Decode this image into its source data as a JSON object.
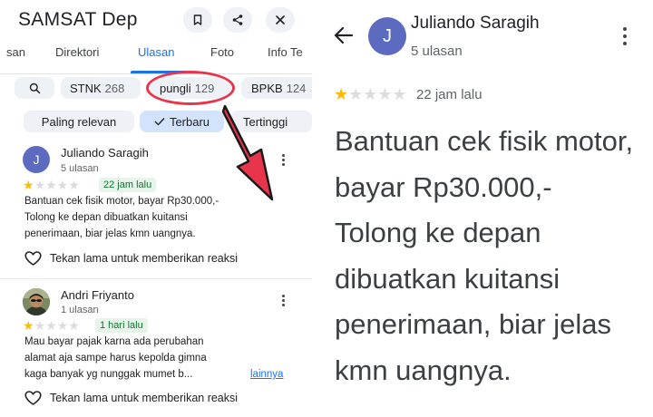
{
  "left": {
    "title": "SAMSAT Dep",
    "header_icons": [
      "bookmark-icon",
      "share-icon",
      "close-icon"
    ],
    "tabs": [
      "san",
      "Direktori",
      "Ulasan",
      "Foto",
      "Info Te"
    ],
    "active_tab": "Ulasan",
    "topic_chips": [
      {
        "label": "STNK",
        "count": "268"
      },
      {
        "label": "pungli",
        "count": "129"
      },
      {
        "label": "BPKB",
        "count": "124"
      }
    ],
    "sort_chips": [
      "Paling relevan",
      "Terbaru",
      "Tertinggi"
    ],
    "sort_selected": "Terbaru",
    "annotation_color": "#e8354b",
    "reviews": [
      {
        "avatar_letter": "J",
        "avatar_color": "#5c6bc0",
        "name": "Juliando Saragih",
        "sub": "5 ulasan",
        "rating": 1,
        "date": "22 jam lalu",
        "lines": [
          "Bantuan cek fisik motor, bayar Rp30.000,-",
          "Tolong ke depan dibuatkan kuitansi",
          "penerimaan,  biar jelas kmn uangnya."
        ],
        "more": "",
        "react": "Tekan lama untuk memberikan reaksi"
      },
      {
        "avatar_letter": "",
        "avatar_color": "#6d7a55",
        "name": "Andri Friyanto",
        "sub": "1 ulasan",
        "rating": 1,
        "date": "1 hari lalu",
        "lines": [
          "Mau bayar pajak karna ada perubahan",
          "alamat aja sampe harus kepolda gimna",
          "kaga banyak yg nunggak mumet b..."
        ],
        "more": "lainnya",
        "react": "Tekan lama untuk memberikan reaksi"
      }
    ]
  },
  "right": {
    "avatar_letter": "J",
    "name": "Juliando Saragih",
    "sub": "5 ulasan",
    "rating": 1,
    "date": "22 jam lalu",
    "text": "Bantuan cek fisik motor,\nbayar Rp30.000,-\nTolong ke depan\ndibuatkan kuitansi\npenerimaan,  biar jelas\nkmn uangnya."
  }
}
